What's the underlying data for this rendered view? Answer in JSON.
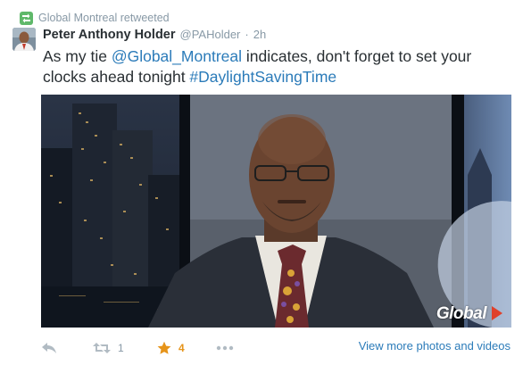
{
  "retweet_context": {
    "text": "Global Montreal retweeted",
    "icon": "retweet-badge-icon",
    "color": "#5fb86a"
  },
  "tweet": {
    "fullname": "Peter Anthony Holder",
    "username": "@PAHolder",
    "separator": "·",
    "time": "2h",
    "text_part1": "As my tie ",
    "mention": "@Global_Montreal",
    "text_part2": " indicates, don't forget to set your clocks ahead tonight ",
    "hashtag": "#DaylightSavingTime",
    "link_color": "#2b7bb9"
  },
  "media": {
    "logo_text": "Global"
  },
  "actions": {
    "reply": {
      "icon": "reply-icon"
    },
    "retweet": {
      "icon": "retweet-icon",
      "count": "1"
    },
    "favorite": {
      "icon": "star-icon",
      "count": "4",
      "color": "#e6941a"
    },
    "more": {
      "icon": "more-dots-icon"
    },
    "view_more": "View more photos and videos"
  }
}
